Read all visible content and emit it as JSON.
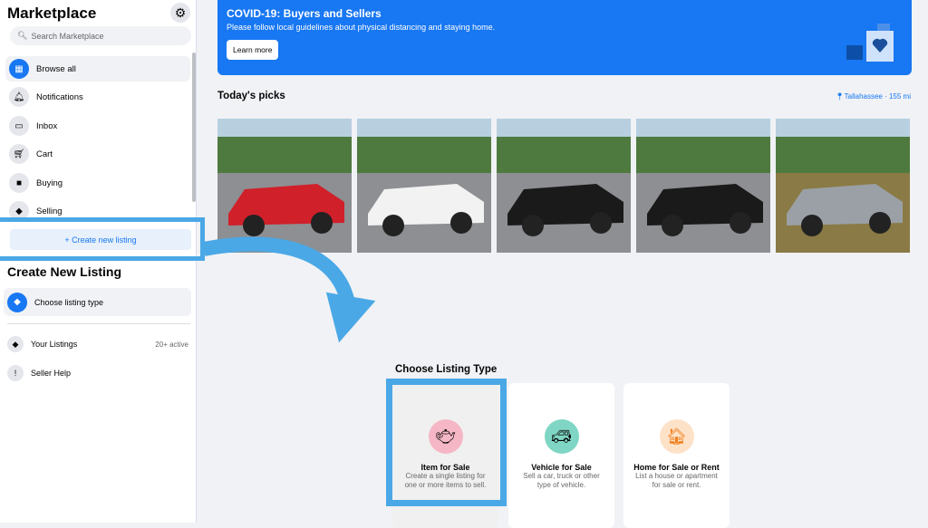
{
  "sidebar": {
    "title": "Marketplace",
    "settings_icon": "gear-icon",
    "search_placeholder": "Search Marketplace",
    "items": [
      {
        "label": "Browse all",
        "icon": "storefront-icon"
      },
      {
        "label": "Notifications",
        "icon": "bell-icon"
      },
      {
        "label": "Inbox",
        "icon": "inbox-icon"
      },
      {
        "label": "Cart",
        "icon": "cart-icon"
      },
      {
        "label": "Buying",
        "icon": "bag-icon"
      },
      {
        "label": "Selling",
        "icon": "tag-icon"
      }
    ],
    "create_button": "+ Create new listing",
    "create_heading": "Create New Listing",
    "choose_type": "Choose listing type",
    "your_listings": "Your Listings",
    "your_listings_count": "20+ active",
    "seller_help": "Seller Help"
  },
  "banner": {
    "title": "COVID-19: Buyers and Sellers",
    "text": "Please follow local guidelines about physical distancing and staying home.",
    "button": "Learn more",
    "color": "#1877f2"
  },
  "picks": {
    "title": "Today's picks",
    "location": "Tallahassee · 155 mi",
    "items": [
      {
        "color": "#d0202a"
      },
      {
        "color": "#f2f2f2"
      },
      {
        "color": "#1a1a1a"
      },
      {
        "color": "#1a1a1a"
      },
      {
        "color": "#9aa0a6"
      }
    ]
  },
  "listing_types": {
    "title": "Choose Listing Type",
    "cards": [
      {
        "title": "Item for Sale",
        "desc": "Create a single listing for one or more items to sell.",
        "icon": "kettle-icon"
      },
      {
        "title": "Vehicle for Sale",
        "desc": "Sell a car, truck or other type of vehicle.",
        "icon": "car-icon"
      },
      {
        "title": "Home for Sale or Rent",
        "desc": "List a house or apartment for sale or rent.",
        "icon": "house-icon"
      }
    ]
  },
  "highlight_color": "#4aa8e6"
}
